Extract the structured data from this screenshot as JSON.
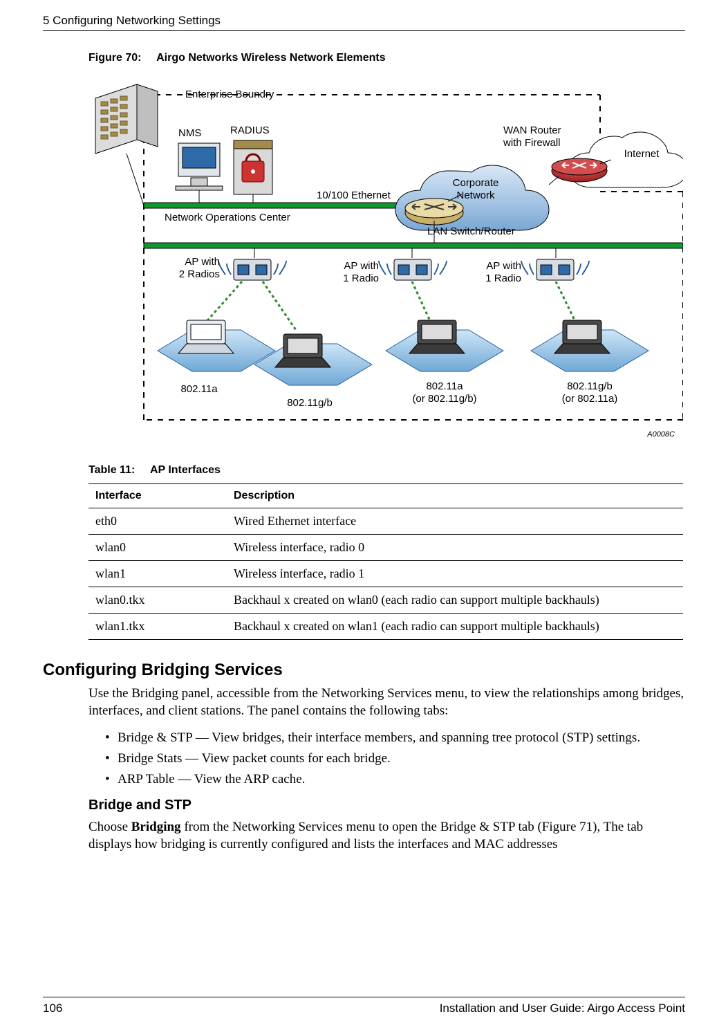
{
  "header": {
    "chapter": "5  Configuring Networking Settings"
  },
  "figure": {
    "caption_label": "Figure 70:",
    "caption_title": "Airgo Networks Wireless Network Elements",
    "labels": {
      "enterprise_boundry": "Enterprise Boundry",
      "nms": "NMS",
      "radius": "RADIUS",
      "ethernet": "10/100 Ethernet",
      "noc": "Network Operations Center",
      "wan_router": "WAN Router\nwith Firewall",
      "internet": "Internet",
      "corporate_network": "Corporate\nNetwork",
      "lan_switch": "LAN Switch/Router",
      "ap_2radios": "AP with\n2 Radios",
      "ap_1radio_a": "AP with\n1 Radio",
      "ap_1radio_b": "AP with\n1 Radio",
      "g1": "802.11a",
      "g2": "802.11g/b",
      "g3": "802.11a\n(or 802.11g/b)",
      "g4": "802.11g/b\n(or 802.11a)",
      "doc_id": "A0008C"
    }
  },
  "table": {
    "caption_label": "Table 11:",
    "caption_title": "AP Interfaces",
    "headers": [
      "Interface",
      "Description"
    ],
    "rows": [
      {
        "c1": "eth0",
        "c2": "Wired Ethernet interface"
      },
      {
        "c1": "wlan0",
        "c2": "Wireless interface, radio 0"
      },
      {
        "c1": "wlan1",
        "c2": "Wireless interface, radio 1"
      },
      {
        "c1": "wlan0.tkx",
        "c2": "Backhaul x created on wlan0 (each radio can support multiple backhauls)"
      },
      {
        "c1": "wlan1.tkx",
        "c2": "Backhaul x created on wlan1 (each radio can support multiple backhauls)"
      }
    ]
  },
  "sections": {
    "bridging_heading": "Configuring Bridging Services",
    "bridging_intro": "Use the Bridging panel, accessible from the Networking Services menu, to view the relationships among bridges, interfaces, and client stations. The panel contains the following tabs:",
    "bullets": [
      "Bridge & STP — View bridges, their interface members, and spanning tree protocol (STP) settings.",
      "Bridge Stats — View packet counts for each bridge.",
      "ARP Table — View the ARP cache."
    ],
    "subhead": "Bridge and STP",
    "sub_para_pre": "Choose ",
    "sub_para_bold": "Bridging",
    "sub_para_post": " from the Networking Services menu to open the Bridge & STP tab (Figure 71), The tab displays how bridging is currently configured and lists the interfaces and MAC addresses"
  },
  "footer": {
    "page": "106",
    "doc_title": "Installation and User Guide: Airgo Access Point"
  }
}
